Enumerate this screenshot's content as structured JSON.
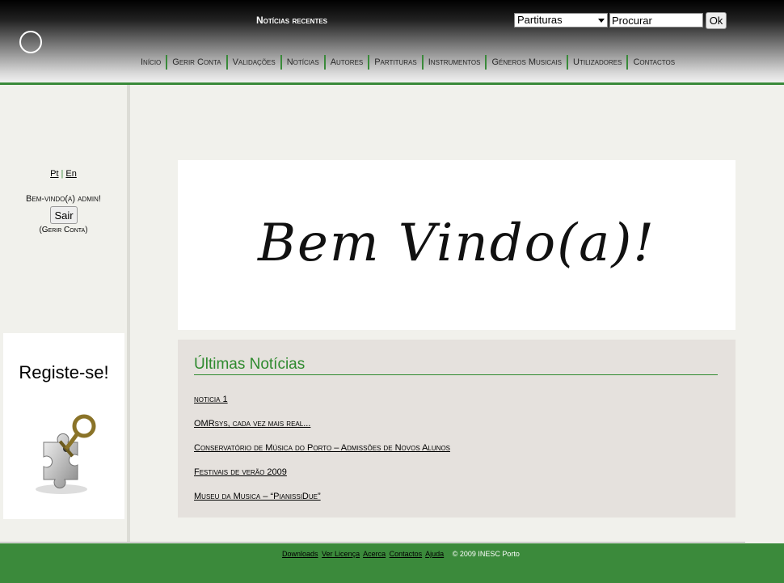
{
  "header": {
    "recent_news": "Notícias recentes",
    "search": {
      "category_selected": "Partituras",
      "input_value": "Procurar",
      "ok_label": "Ok"
    },
    "nav": [
      "Início",
      "Gerir Conta",
      "Validações",
      "Notícias",
      "Autores",
      "Partituras",
      "Instrumentos",
      "Géneros Musicais",
      "Utilizadores",
      "Contactos"
    ]
  },
  "sidebar": {
    "lang_pt": "Pt",
    "lang_sep": "|",
    "lang_en": "En",
    "welcome_text": "Bem-vindo(a) admin!",
    "logout_label": "Sair",
    "manage_open": "(",
    "manage_label": "Gerir Conta",
    "manage_close": ")",
    "register_title": "Registe-se!"
  },
  "main": {
    "banner_title": "Bem Vindo(a)!",
    "news_heading": "Últimas Notícias",
    "news_items": [
      "noticia 1",
      "OMRsys, cada vez mais real...",
      "Conservatório de Música do Porto – Admissões de Novos Alunos",
      "Festivais de verão 2009",
      "Museu da Musica – “PianissiDue”"
    ]
  },
  "footer": {
    "links": [
      "Downloads",
      "Ver Licença",
      "Acerca",
      "Contactos",
      "Ajuda"
    ],
    "copyright": "© 2009 INESC Porto"
  },
  "colors": {
    "accent_green": "#3a8a3a",
    "news_panel_bg": "#e5e1dd",
    "page_bg": "#f1f1ec"
  }
}
